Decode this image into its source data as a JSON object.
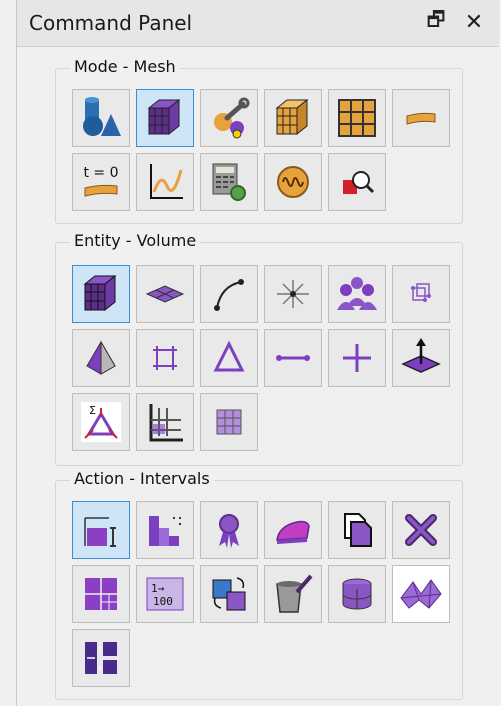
{
  "panel": {
    "title": "Command Panel",
    "float_glyph": "🗗",
    "close_glyph": "✕"
  },
  "groups": [
    {
      "label": "Mode - Mesh",
      "selected_index": 1,
      "buttons": [
        "geometry-mode",
        "mesh-mode",
        "tools-mode",
        "hex-mesh-mode",
        "grid-mode",
        "material-strip-mode",
        "time-zero-mode",
        "plot-mode",
        "calculator-mode",
        "signal-mode",
        "inspect-mode"
      ]
    },
    {
      "label": "Entity - Volume",
      "selected_index": 0,
      "buttons": [
        "volume",
        "surface",
        "curve",
        "vertex",
        "group",
        "node-hex",
        "tetra",
        "quad",
        "triangle",
        "edge",
        "node",
        "normal-surface",
        "sideset",
        "block",
        "element-grid"
      ]
    },
    {
      "label": "Action - Intervals",
      "selected_index": 0,
      "buttons": [
        "intervals",
        "scheme",
        "quality",
        "smooth",
        "copy",
        "delete",
        "refine",
        "renumber",
        "swap",
        "clean",
        "cylinder",
        "morph",
        "split"
      ]
    }
  ],
  "time_zero_label": "t = 0",
  "renumber_top": "1→",
  "renumber_bottom": "100",
  "sigma_label": "Σ",
  "colors": {
    "selected_bg": "#cde5f7",
    "selected_border": "#3c8dd0",
    "accent_purple": "#7b3fbf",
    "accent_orange": "#e6a23c"
  }
}
